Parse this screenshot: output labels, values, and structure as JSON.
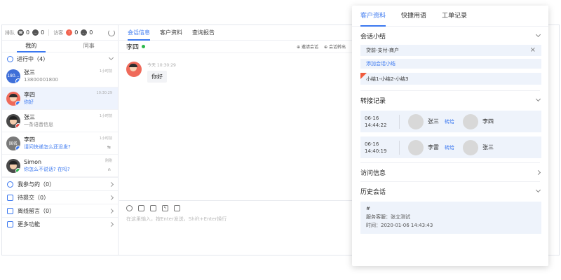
{
  "left": {
    "stats": {
      "queue_label": "排队",
      "queue_a": "0",
      "queue_b": "0",
      "visitor_label": "访客",
      "visitor_a": "0",
      "visitor_b": "0"
    },
    "tabs": [
      "我的",
      "同事"
    ],
    "in_progress": "进行中（4）",
    "sessions": [
      {
        "name": "张三",
        "sub": "13800001800",
        "meta": "1小时前",
        "avatar_text": "180…"
      },
      {
        "name": "李四",
        "sub": "你好",
        "meta": "10:30:29"
      },
      {
        "name": "张三",
        "sub": "一条语音信息",
        "meta": "1小时前"
      },
      {
        "name": "李四",
        "sub": "请问快递怎么还没发?",
        "meta": "1小时前",
        "avatar_text": "国名"
      },
      {
        "name": "Simon",
        "sub": "你怎么不说话? 在吗?",
        "meta": "刚刚"
      }
    ],
    "menu": [
      {
        "label": "我参与的（0）"
      },
      {
        "label": "待提交（0）"
      },
      {
        "label": "离线留言（0）"
      },
      {
        "label": "更多功能"
      }
    ]
  },
  "chat": {
    "tabs": [
      "会话信息",
      "客户资料",
      "查询报告"
    ],
    "contact": "李四",
    "actions": [
      "邀请会话",
      "会话转出"
    ],
    "message": {
      "time": "今天 10:30:29",
      "text": "你好"
    },
    "placeholder": "在这里输入，按Enter发送，Shift+Enter换行"
  },
  "panel": {
    "tabs": [
      "客户资料",
      "快捷用语",
      "工单记录"
    ],
    "summary_title": "会话小结",
    "summary_tag": "贷前-支付-商户",
    "add_summary": "添加会话小结",
    "summary_item": "小结1-小结2-小结3",
    "transfer_title": "转接记录",
    "transfers": [
      {
        "date": "06-16",
        "time": "14:44:22",
        "from": "张三",
        "to": "李四",
        "arrow": "转给"
      },
      {
        "date": "06-16",
        "time": "14:40:19",
        "from": "李雷",
        "to": "张三",
        "arrow": "转给"
      }
    ],
    "visit_title": "访问信息",
    "history_title": "历史会话",
    "history": {
      "hash": "#",
      "agent": "服务客服：张立测试",
      "time": "时间：2020-01-06 14:43:43"
    }
  }
}
